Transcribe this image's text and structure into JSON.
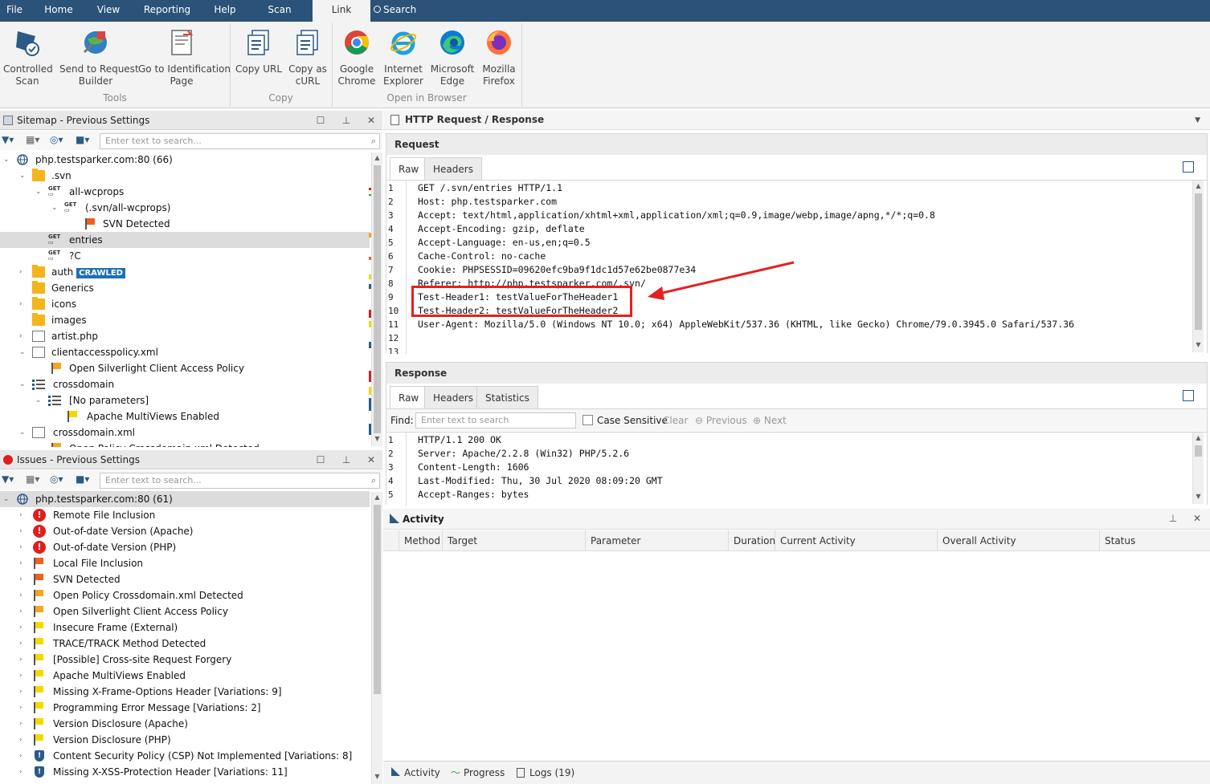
{
  "menu": {
    "items": [
      "File",
      "Home",
      "View",
      "Reporting",
      "Help",
      "Scan",
      "Link"
    ],
    "search_label": "Search"
  },
  "ribbon": {
    "tools": [
      {
        "label": "Controlled\nScan",
        "icon": "controlled-scan-icon"
      },
      {
        "label": "Send to Request\nBuilder",
        "icon": "request-builder-icon"
      },
      {
        "label": "Go to Identification\nPage",
        "icon": "identification-page-icon"
      }
    ],
    "copy": [
      {
        "label": "Copy URL",
        "icon": "copy-url-icon"
      },
      {
        "label": "Copy as\ncURL",
        "icon": "copy-curl-icon"
      }
    ],
    "browsers": [
      {
        "label": "Google\nChrome",
        "icon": "chrome-icon"
      },
      {
        "label": "Internet\nExplorer",
        "icon": "ie-icon"
      },
      {
        "label": "Microsoft\nEdge",
        "icon": "edge-icon"
      },
      {
        "label": "Mozilla\nFirefox",
        "icon": "firefox-icon"
      }
    ],
    "groups": {
      "tools": "Tools",
      "copy": "Copy",
      "browser": "Open in Browser"
    }
  },
  "sitemap": {
    "title": "Sitemap - Previous Settings",
    "search_placeholder": "Enter text to search...",
    "rows": [
      {
        "label": "php.testsparker.com:80 (66)"
      },
      {
        "label": ".svn"
      },
      {
        "label": "all-wcprops"
      },
      {
        "label": "(.svn/all-wcprops)"
      },
      {
        "label": "SVN Detected"
      },
      {
        "label": "entries"
      },
      {
        "label": "?C"
      },
      {
        "label": "auth",
        "badge": "CRAWLED"
      },
      {
        "label": "Generics"
      },
      {
        "label": "icons"
      },
      {
        "label": "images"
      },
      {
        "label": "artist.php"
      },
      {
        "label": "clientaccesspolicy.xml"
      },
      {
        "label": "Open Silverlight Client Access Policy"
      },
      {
        "label": "crossdomain"
      },
      {
        "label": "[No parameters]"
      },
      {
        "label": "Apache MultiViews Enabled"
      },
      {
        "label": "crossdomain.xml"
      },
      {
        "label": "Open Policy Crossdomain.xml Detected"
      }
    ]
  },
  "issues": {
    "title": "Issues - Previous Settings",
    "search_placeholder": "Enter text to search...",
    "root": "php.testsparker.com:80 (61)",
    "rows": [
      {
        "label": "Remote File Inclusion",
        "sev": "critical"
      },
      {
        "label": "Out-of-date Version (Apache)",
        "sev": "critical"
      },
      {
        "label": "Out-of-date Version (PHP)",
        "sev": "critical"
      },
      {
        "label": "Local File Inclusion",
        "sev": "high"
      },
      {
        "label": "SVN Detected",
        "sev": "high"
      },
      {
        "label": "Open Policy Crossdomain.xml Detected",
        "sev": "medium"
      },
      {
        "label": "Open Silverlight Client Access Policy",
        "sev": "medium"
      },
      {
        "label": "Insecure Frame (External)",
        "sev": "low"
      },
      {
        "label": "TRACE/TRACK Method Detected",
        "sev": "low"
      },
      {
        "label": "[Possible] Cross-site Request Forgery",
        "sev": "low"
      },
      {
        "label": "Apache MultiViews Enabled",
        "sev": "low"
      },
      {
        "label": "Missing X-Frame-Options Header [Variations: 9]",
        "sev": "low"
      },
      {
        "label": "Programming Error Message [Variations: 2]",
        "sev": "low"
      },
      {
        "label": "Version Disclosure (Apache)",
        "sev": "low"
      },
      {
        "label": "Version Disclosure (PHP)",
        "sev": "low"
      },
      {
        "label": "Content Security Policy (CSP) Not Implemented [Variations: 8]",
        "sev": "info"
      },
      {
        "label": "Missing X-XSS-Protection Header [Variations: 11]",
        "sev": "info"
      }
    ]
  },
  "http": {
    "title": "HTTP Request / Response",
    "request_label": "Request",
    "request_tabs": [
      "Raw",
      "Headers"
    ],
    "request_lines": [
      "GET /.svn/entries HTTP/1.1",
      "Host: php.testsparker.com",
      "Accept: text/html,application/xhtml+xml,application/xml;q=0.9,image/webp,image/apng,*/*;q=0.8",
      "Accept-Encoding: gzip, deflate",
      "Accept-Language: en-us,en;q=0.5",
      "Cache-Control: no-cache",
      "Cookie: PHPSESSID=09620efc9ba9f1dc1d57e62be0877e34",
      "Referer: http://php.testsparker.com/.svn/",
      "Test-Header1: testValueForTheHeader1",
      "Test-Header2: testValueForTheHeader2",
      "User-Agent: Mozilla/5.0 (Windows NT 10.0; x64) AppleWebKit/537.36 (KHTML, like Gecko) Chrome/79.0.3945.0 Safari/537.36",
      "",
      ""
    ],
    "response_label": "Response",
    "response_tabs": [
      "Raw",
      "Headers",
      "Statistics"
    ],
    "find_label": "Find:",
    "find_placeholder": "Enter text to search",
    "case_sensitive": "Case Sensitive",
    "clear": "Clear",
    "previous": "Previous",
    "next": "Next",
    "response_lines": [
      "HTTP/1.1 200 OK",
      "Server: Apache/2.2.8 (Win32) PHP/5.2.6",
      "Content-Length: 1606",
      "Last-Modified: Thu, 30 Jul 2020 08:09:20 GMT",
      "Accept-Ranges: bytes"
    ]
  },
  "activity": {
    "title": "Activity",
    "columns": [
      "Method",
      "Target",
      "Parameter",
      "Duration",
      "Current Activity",
      "Overall Activity",
      "Status"
    ],
    "bottom_tabs": [
      "Activity",
      "Progress",
      "Logs (19)"
    ]
  },
  "colors": {
    "menubar": "#2b5278",
    "critical": "#e01e1e",
    "high": "#f06020",
    "medium": "#f5a623",
    "low": "#f5d800",
    "info": "#2b5a86",
    "annotation": "#e52020"
  }
}
